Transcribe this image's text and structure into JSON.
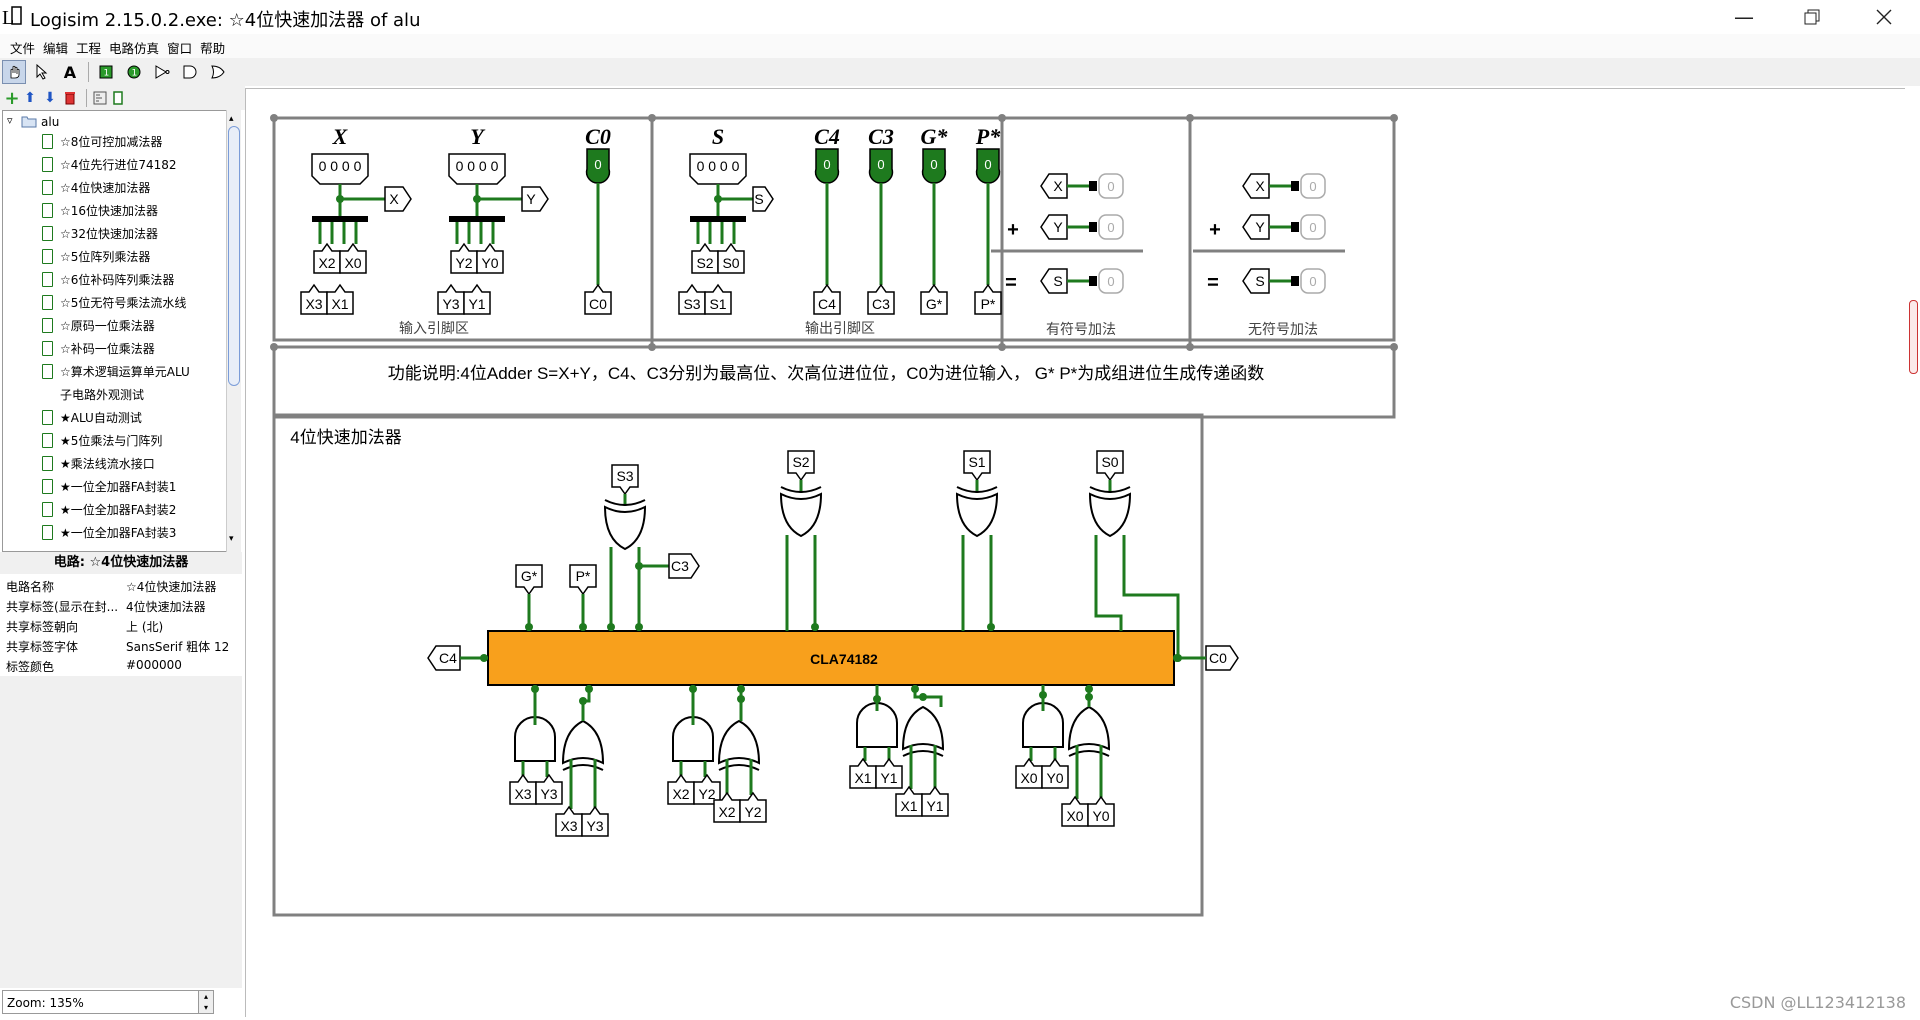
{
  "window": {
    "title": "Logisim 2.15.0.2.exe: ☆4位快速加法器 of alu",
    "minimize_icon": "minimize-icon",
    "maximize_icon": "restore-icon",
    "close_icon": "close-icon"
  },
  "menu": [
    "文件",
    "编辑",
    "工程",
    "电路仿真",
    "窗口",
    "帮助"
  ],
  "tree": {
    "root": "alu",
    "items": [
      "☆8位可控加减法器",
      "☆4位先行进位74182",
      "☆4位快速加法器",
      "☆16位快速加法器",
      "☆32位快速加法器",
      "☆5位阵列乘法器",
      "☆6位补码阵列乘法器",
      "☆5位无符号乘法流水线",
      "☆原码一位乘法器",
      "☆补码一位乘法器",
      "☆算术逻辑运算单元ALU",
      "子电路外观测试",
      "★ALU自动测试",
      "★5位乘法与门阵列",
      "★乘法线流水接口",
      "★一位全加器FA封装1",
      "★一位全加器FA封装2",
      "★一位全加器FA封装3"
    ],
    "selected_index": 2
  },
  "properties": {
    "header": "电路: ☆4位快速加法器",
    "rows": [
      {
        "key": "电路名称",
        "value": "☆4位快速加法器"
      },
      {
        "key": "共享标签(显示在封...",
        "value": "4位快速加法器"
      },
      {
        "key": "共享标签朝向",
        "value": "上 (北)"
      },
      {
        "key": "共享标签字体",
        "value": "SansSerif 粗体 12"
      },
      {
        "key": "标签颜色",
        "value": "#000000"
      }
    ]
  },
  "zoom": "Zoom: 135%",
  "circuit": {
    "input_labels": {
      "X": "X",
      "Y": "Y",
      "C0": "C0"
    },
    "output_labels": {
      "S": "S",
      "C4": "C4",
      "C3": "C3",
      "G": "G*",
      "P": "P*"
    },
    "bits_display": "0 0 0 0",
    "pin_value": "0",
    "section_input": "输入引脚区",
    "section_output": "输出引脚区",
    "section_signed": "有符号加法",
    "section_unsigned": "无符号加法",
    "description": "功能说明:4位Adder  S=X+Y，C4、C3分别为最高位、次高位进位位，C0为进位输入， G* P*为成组进位生成传递函数",
    "main_title": "4位快速加法器",
    "chip_label": "CLA74182",
    "tunnels": {
      "X2": "X2",
      "X0": "X0",
      "X3": "X3",
      "X1": "X1",
      "Y2": "Y2",
      "Y0": "Y0",
      "Y3": "Y3",
      "Y1": "Y1",
      "S2": "S2",
      "S0": "S0",
      "S3": "S3",
      "S1": "S1",
      "C0": "C0",
      "C4": "C4",
      "C3": "C3",
      "G": "G*",
      "P": "P*"
    },
    "plus": "+",
    "equals": "="
  },
  "watermark": "CSDN @LL123412138",
  "colors": {
    "wire": "#1e7a1e",
    "chip": "#f8a01c",
    "pin_on": "#1e7a1e"
  }
}
